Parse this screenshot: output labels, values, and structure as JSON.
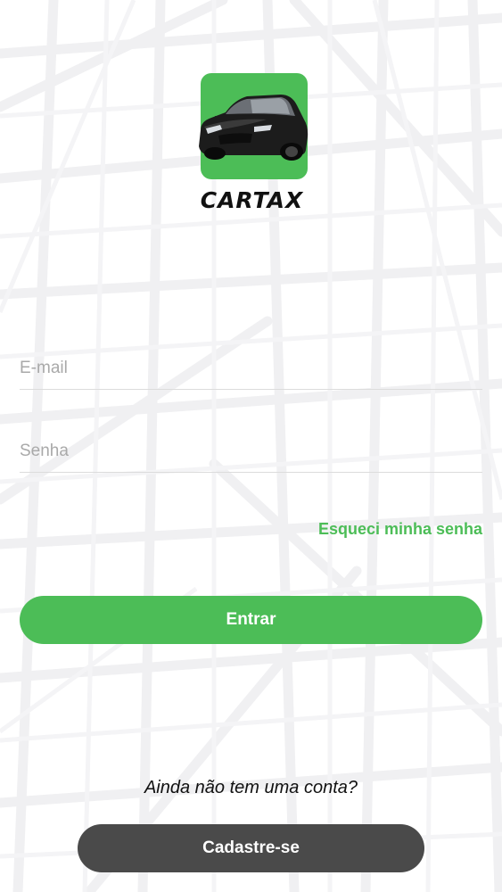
{
  "app": {
    "name": "CARTAX"
  },
  "login": {
    "email": {
      "placeholder": "E-mail",
      "value": ""
    },
    "password": {
      "placeholder": "Senha",
      "value": ""
    },
    "forgot_label": "Esqueci minha senha",
    "enter_label": "Entrar"
  },
  "signup": {
    "prompt": "Ainda não tem uma conta?",
    "button_label": "Cadastre-se"
  },
  "colors": {
    "accent": "#4cbd57",
    "dark_button": "#4a4a4a",
    "map_streets": "#f1f1f3"
  },
  "icons": {
    "logo": "car-icon"
  }
}
